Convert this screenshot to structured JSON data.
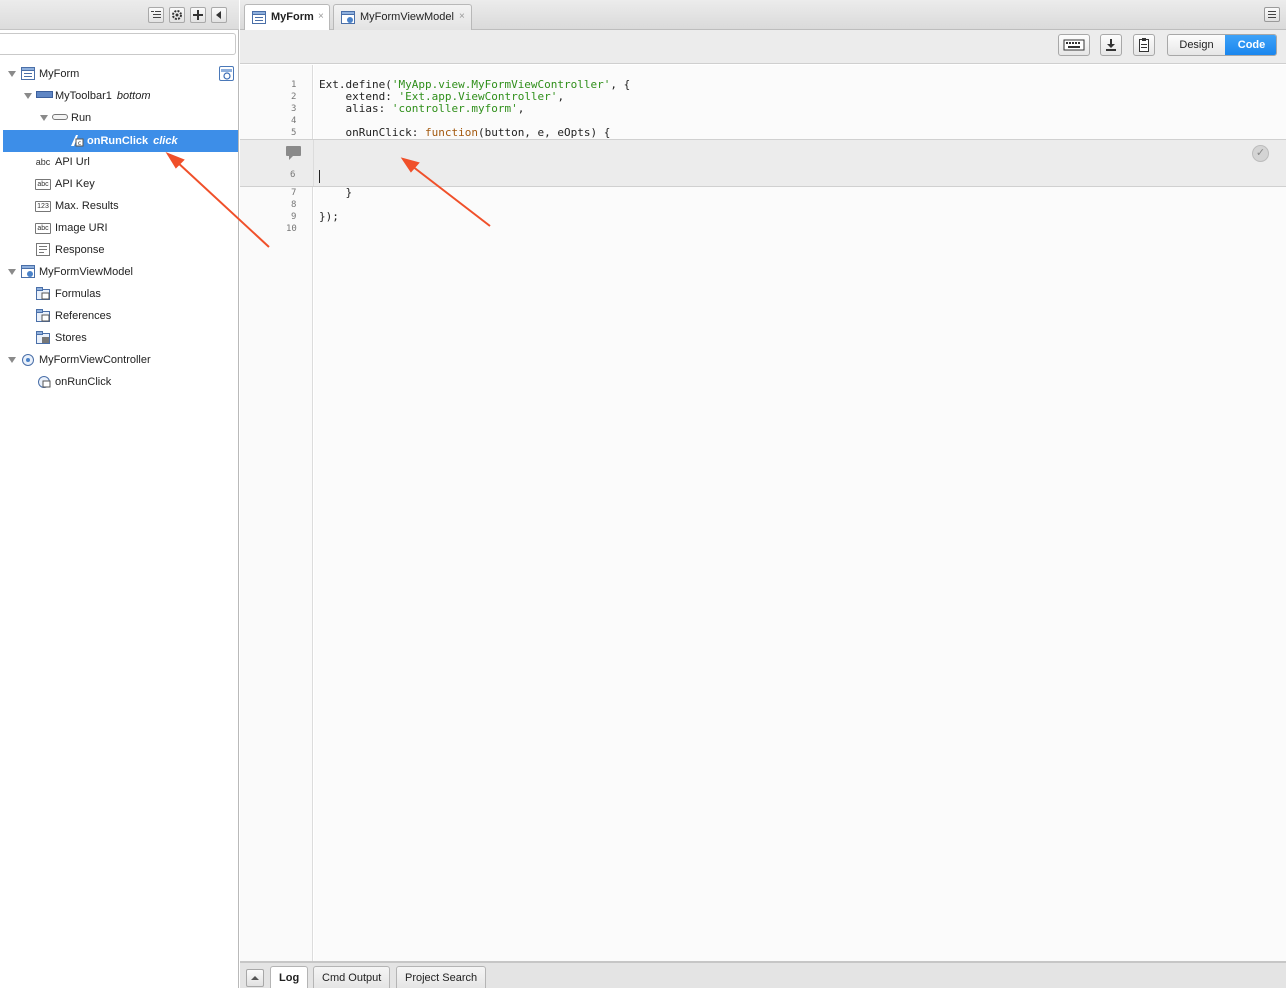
{
  "inspector": {
    "toolbar": {
      "buttons": [
        "list-view-icon",
        "gear-icon",
        "plus-icon",
        "collapse-left-icon"
      ]
    },
    "filter": {
      "placeholder": ""
    },
    "tree": [
      {
        "label": "MyForm",
        "sub": "",
        "icon": "form-icon"
      },
      {
        "label": "MyToolbar1",
        "sub": "bottom",
        "icon": "toolbar-icon"
      },
      {
        "label": "Run",
        "sub": "",
        "icon": "button-icon"
      },
      {
        "label": "onRunClick",
        "sub": "click",
        "icon": "event-binding-icon"
      },
      {
        "label": "API Url",
        "sub": "",
        "icon": "text-field-icon",
        "badge": "abc"
      },
      {
        "label": "API Key",
        "sub": "",
        "icon": "text-field-icon",
        "badge": "abc"
      },
      {
        "label": "Max. Results",
        "sub": "",
        "icon": "number-field-icon",
        "badge": "123"
      },
      {
        "label": "Image URI",
        "sub": "",
        "icon": "text-field-icon",
        "badge": "abc"
      },
      {
        "label": "Response",
        "sub": "",
        "icon": "textarea-icon"
      },
      {
        "label": "MyFormViewModel",
        "sub": "",
        "icon": "viewmodel-icon"
      },
      {
        "label": "Formulas",
        "sub": "",
        "icon": "formulas-icon"
      },
      {
        "label": "References",
        "sub": "",
        "icon": "references-icon"
      },
      {
        "label": "Stores",
        "sub": "",
        "icon": "stores-icon"
      },
      {
        "label": "MyFormViewController",
        "sub": "",
        "icon": "viewcontroller-icon"
      },
      {
        "label": "onRunClick",
        "sub": "",
        "icon": "function-icon"
      }
    ]
  },
  "editor": {
    "tabs": [
      {
        "label": "MyForm",
        "active": true
      },
      {
        "label": "MyFormViewModel",
        "active": false
      }
    ],
    "close_glyph": "×",
    "view_toggle": {
      "design": "Design",
      "code": "Code",
      "selected": "Code"
    },
    "code_lines": [
      {
        "n": "1",
        "text": "Ext.define('MyApp.view.MyFormViewController', {"
      },
      {
        "n": "2",
        "text": "    extend: 'Ext.app.ViewController',"
      },
      {
        "n": "3",
        "text": "    alias: 'controller.myform',"
      },
      {
        "n": "4",
        "text": ""
      },
      {
        "n": "5",
        "text": "    onRunClick: function(button, e, eOpts) {"
      },
      {
        "n": "6",
        "text": ""
      },
      {
        "n": "7",
        "text": "    }"
      },
      {
        "n": "8",
        "text": ""
      },
      {
        "n": "9",
        "text": "});"
      },
      {
        "n": "10",
        "text": ""
      }
    ]
  },
  "bottom_tabs": [
    {
      "label": "Log",
      "active": true
    },
    {
      "label": "Cmd Output",
      "active": false
    },
    {
      "label": "Project Search",
      "active": false
    }
  ],
  "colors": {
    "selection": "#3d8ee8",
    "code_toggle": "#1a86ee",
    "string": "#2f8f1a",
    "keyword": "#a3590f",
    "arrow": "#f0502a"
  }
}
